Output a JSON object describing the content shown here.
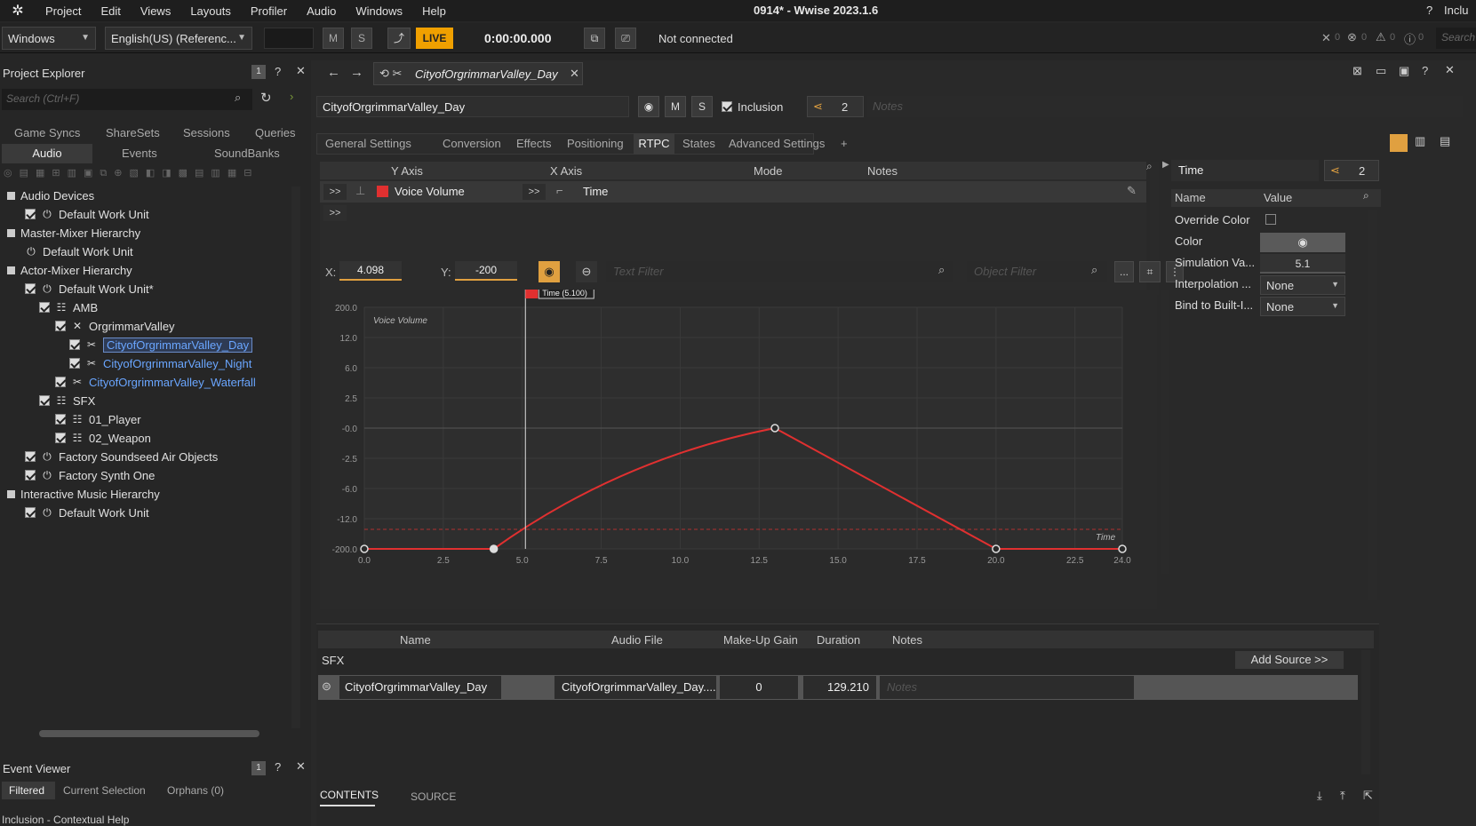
{
  "menu": {
    "items": [
      "Project",
      "Edit",
      "Views",
      "Layouts",
      "Profiler",
      "Audio",
      "Windows",
      "Help"
    ],
    "title": "0914* - Wwise 2023.1.6",
    "right_label": "Inclu"
  },
  "toolbar": {
    "platform": "Windows",
    "language": "English(US) (Referenc...",
    "m_label": "M",
    "s_label": "S",
    "live_label": "LIVE",
    "time": "0:00:00.000",
    "connection": "Not connected",
    "counts": [
      "0",
      "0",
      "0",
      "0"
    ],
    "search_right": "Search"
  },
  "project_explorer": {
    "title": "Project Explorer",
    "search_placeholder": "Search (Ctrl+F)",
    "tabs_row1": [
      "Game Syncs",
      "ShareSets",
      "Sessions",
      "Queries"
    ],
    "tabs_row2": [
      "Audio",
      "Events",
      "SoundBanks"
    ],
    "tree": [
      {
        "label": "Audio Devices",
        "depth": 0,
        "kind": "root"
      },
      {
        "label": "Default Work Unit",
        "depth": 1,
        "kind": "wu",
        "check": true
      },
      {
        "label": "Master-Mixer Hierarchy",
        "depth": 0,
        "kind": "root"
      },
      {
        "label": "Default Work Unit",
        "depth": 1,
        "kind": "wu",
        "check": false
      },
      {
        "label": "Actor-Mixer Hierarchy",
        "depth": 0,
        "kind": "root"
      },
      {
        "label": "Default Work Unit*",
        "depth": 1,
        "kind": "wu",
        "check": true
      },
      {
        "label": "AMB",
        "depth": 2,
        "kind": "am",
        "check": true
      },
      {
        "label": "OrgrimmarValley",
        "depth": 3,
        "kind": "rnd",
        "check": true
      },
      {
        "label": "CityofOrgrimmarValley_Day",
        "depth": 4,
        "kind": "snd",
        "check": true,
        "selected": true
      },
      {
        "label": "CityofOrgrimmarValley_Night",
        "depth": 4,
        "kind": "snd",
        "check": true
      },
      {
        "label": "CityofOrgrimmarValley_Waterfall",
        "depth": 3,
        "kind": "snd",
        "check": true
      },
      {
        "label": "SFX",
        "depth": 2,
        "kind": "am",
        "check": true
      },
      {
        "label": "01_Player",
        "depth": 3,
        "kind": "am",
        "check": true
      },
      {
        "label": "02_Weapon",
        "depth": 3,
        "kind": "am",
        "check": true
      },
      {
        "label": "Factory Soundseed Air Objects",
        "depth": 1,
        "kind": "wu",
        "check": true
      },
      {
        "label": "Factory Synth One",
        "depth": 1,
        "kind": "wu",
        "check": true
      },
      {
        "label": "Interactive Music Hierarchy",
        "depth": 0,
        "kind": "root"
      },
      {
        "label": "Default Work Unit",
        "depth": 1,
        "kind": "wu",
        "check": true
      }
    ]
  },
  "event_viewer": {
    "title": "Event Viewer",
    "tabs": [
      "Filtered",
      "Current Selection",
      "Orphans (0)"
    ],
    "help_title": "Inclusion - Contextual Help"
  },
  "editor": {
    "tab_title": "CityofOrgrimmarValley_Day",
    "object_name": "CityofOrgrimmarValley_Day",
    "m_label": "M",
    "s_label": "S",
    "inclusion_label": "Inclusion",
    "share_count": "2",
    "notes_placeholder": "Notes",
    "tabs": [
      "General Settings",
      "Conversion",
      "Effects",
      "Positioning",
      "RTPC",
      "States",
      "Advanced Settings",
      "+"
    ],
    "rtpc_headers": [
      "Y Axis",
      "X Axis",
      "Mode",
      "Notes"
    ],
    "rtpc_row": {
      "y_axis": "Voice Volume",
      "x_axis": "Time",
      "expand": ">>"
    },
    "x_label": "X:",
    "x_value": "4.098",
    "y_label": "Y:",
    "y_value": "-200",
    "text_filter": "Text Filter",
    "object_filter": "Object Filter",
    "more_label": "..."
  },
  "chart_data": {
    "type": "line",
    "title": "Voice Volume",
    "xlabel": "Time",
    "xlim": [
      0,
      24
    ],
    "x_ticks": [
      "0.0",
      "2.5",
      "5.0",
      "7.5",
      "10.0",
      "12.5",
      "15.0",
      "17.5",
      "20.0",
      "22.5",
      "24.0"
    ],
    "y_ticks": [
      "200.0",
      "12.0",
      "6.0",
      "2.5",
      "-0.0",
      "-2.5",
      "-6.0",
      "-12.0",
      "-200.0"
    ],
    "points": [
      {
        "x": 0.0,
        "y": -200
      },
      {
        "x": 4.098,
        "y": -200
      },
      {
        "x": 13.0,
        "y": 0
      },
      {
        "x": 20.0,
        "y": -200
      },
      {
        "x": 24.0,
        "y": -200
      }
    ],
    "cursor_label": "Time (5.100)",
    "cursor_x": 5.1,
    "series_color": "#e03030"
  },
  "properties": {
    "search_label": "Time",
    "share_count": "2",
    "headers": [
      "Name",
      "Value"
    ],
    "rows": [
      {
        "name": "Override Color",
        "value": ""
      },
      {
        "name": "Color",
        "value": ""
      },
      {
        "name": "Simulation Va...",
        "value": "5.1"
      },
      {
        "name": "Interpolation ...",
        "value": "None"
      },
      {
        "name": "Bind to Built-I...",
        "value": "None"
      }
    ]
  },
  "sources": {
    "headers": [
      "Name",
      "Audio File",
      "Make-Up Gain",
      "Duration",
      "Notes"
    ],
    "group": "SFX",
    "add_source": "Add Source >>",
    "row": {
      "name": "CityofOrgrimmarValley_Day",
      "file": "CityofOrgrimmarValley_Day....",
      "gain": "0",
      "duration": "129.210",
      "notes": "Notes"
    },
    "bottom_tabs": [
      "CONTENTS",
      "SOURCE"
    ]
  }
}
